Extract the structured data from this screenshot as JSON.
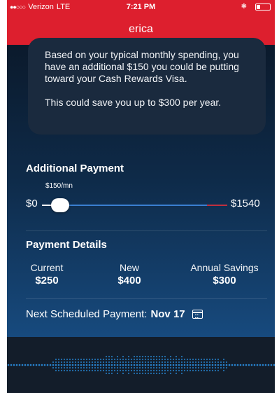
{
  "status_bar": {
    "signal_dots": "●●○○○",
    "carrier": "Verizon",
    "network": "LTE",
    "time": "7:21 PM",
    "bluetooth_icon": "bluetooth-icon",
    "battery_level": 0.3
  },
  "header": {
    "title": "erica"
  },
  "message": {
    "paragraph_1": "Based on your typical monthly spending, you have an additional $150 you could be putting toward your Cash Rewards Visa.",
    "paragraph_2": "This could save you up to $300 per year."
  },
  "additional_payment": {
    "title": "Additional Payment",
    "selected_label": "$150/mn",
    "min_label": "$0",
    "max_label": "$1540",
    "selected_value": 150,
    "min_value": 0,
    "max_value": 1540,
    "colors": {
      "track": "#3a7fd0",
      "limit": "#c02f3e",
      "thumb": "#ffffff"
    }
  },
  "payment_details": {
    "title": "Payment Details",
    "columns": [
      {
        "label": "Current",
        "value": "$250"
      },
      {
        "label": "New",
        "value": "$400"
      },
      {
        "label": "Annual Savings",
        "value": "$300"
      }
    ]
  },
  "next_payment": {
    "label": "Next Scheduled Payment:",
    "date": "Nov 17",
    "icon": "calendar-icon"
  },
  "colors": {
    "brand_red": "#dd1f2e",
    "background_dark": "#0b1a2c",
    "footer": "#131d2a",
    "wave": "#2a8fe0"
  }
}
